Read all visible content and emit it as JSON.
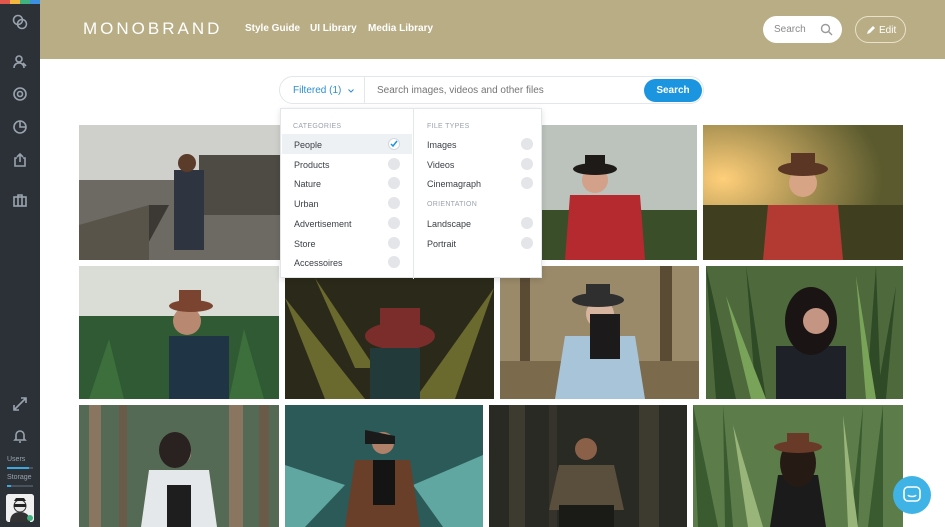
{
  "rail": {
    "users_label": "Users",
    "storage_label": "Storage",
    "users_level": 0.85,
    "storage_level": 0.15
  },
  "header": {
    "logo": "MONOBRAND",
    "nav": [
      "Style Guide",
      "UI Library",
      "Media Library"
    ],
    "search_placeholder": "Search",
    "edit_label": "Edit"
  },
  "search": {
    "filter_label": "Filtered (1)",
    "placeholder": "Search images, videos and other files",
    "button_label": "Search"
  },
  "filters": {
    "categories_title": "CATEGORIES",
    "categories": [
      {
        "label": "People",
        "checked": true
      },
      {
        "label": "Products",
        "checked": false
      },
      {
        "label": "Nature",
        "checked": false
      },
      {
        "label": "Urban",
        "checked": false
      },
      {
        "label": "Advertisement",
        "checked": false
      },
      {
        "label": "Store",
        "checked": false
      },
      {
        "label": "Accessoires",
        "checked": false
      }
    ],
    "file_types_title": "FILE TYPES",
    "file_types": [
      {
        "label": "Images",
        "checked": false
      },
      {
        "label": "Videos",
        "checked": false
      },
      {
        "label": "Cinemagraph",
        "checked": false
      }
    ],
    "orientation_title": "ORIENTATION",
    "orientation": [
      {
        "label": "Landscape",
        "checked": false
      },
      {
        "label": "Portrait",
        "checked": false
      }
    ]
  },
  "colors": {
    "header_bg": "#b8ad84",
    "accent": "#1b95df",
    "rail_bg": "#2c3138"
  }
}
